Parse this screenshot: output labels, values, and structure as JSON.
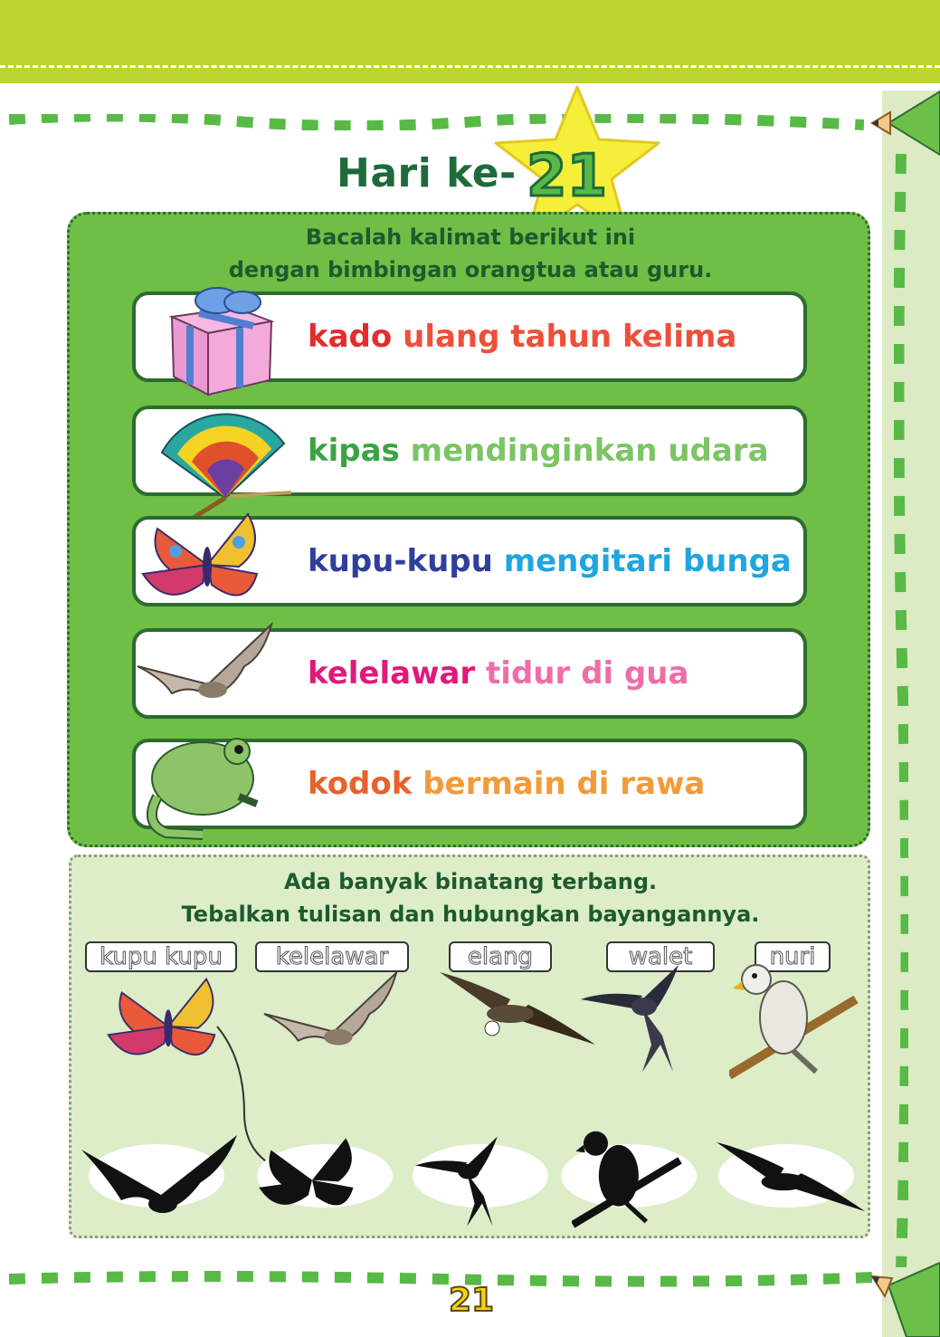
{
  "header": {
    "title_prefix": "Hari ke-",
    "day_number": "21"
  },
  "reading": {
    "instruction_line1": "Bacalah kalimat berikut ini",
    "instruction_line2": "dengan bimbingan orangtua atau guru.",
    "rows": [
      {
        "word": "kado",
        "rest": "ulang tahun kelima",
        "word_color": "#e32c2c",
        "rest_color": "#ee4f3a",
        "icon": "gift-icon"
      },
      {
        "word": "kipas",
        "rest": "mendinginkan udara",
        "word_color": "#3aa442",
        "rest_color": "#7cc464",
        "icon": "fan-icon"
      },
      {
        "word": "kupu-kupu",
        "rest": "mengitari bunga",
        "word_color": "#2f3f9a",
        "rest_color": "#1fa6df",
        "icon": "butterfly-icon"
      },
      {
        "word": "kelelawar",
        "rest": "tidur di gua",
        "word_color": "#e0197a",
        "rest_color": "#ee6ea8",
        "icon": "bat-icon"
      },
      {
        "word": "kodok",
        "rest": "bermain di rawa",
        "word_color": "#e8622b",
        "rest_color": "#f39a3a",
        "icon": "frog-icon"
      }
    ]
  },
  "matching": {
    "instruction_line1": "Ada banyak binatang terbang.",
    "instruction_line2": "Tebalkan tulisan dan hubungkan bayangannya.",
    "labels": [
      "kupu kupu",
      "kelelawar",
      "elang",
      "walet",
      "nuri"
    ],
    "animals": [
      "butterfly-icon",
      "bat-icon",
      "eagle-icon",
      "swallow-icon",
      "parrot-icon"
    ],
    "shadows": [
      "bat-silhouette-icon",
      "butterfly-silhouette-icon",
      "swallow-silhouette-icon",
      "parrot-silhouette-icon",
      "eagle-silhouette-icon"
    ]
  },
  "footer": {
    "page_number": "21"
  },
  "colors": {
    "top_bar": "#bcd531",
    "panel_green": "#6fbe46",
    "panel_light": "#dcedc8",
    "title_green": "#1d6b3b"
  }
}
